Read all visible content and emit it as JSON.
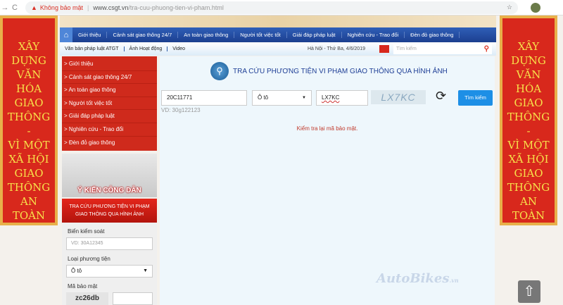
{
  "browser": {
    "security_label": "Không bảo mật",
    "domain": "www.csgt.vn",
    "path": "/tra-cuu-phuong-tien-vi-pham.html"
  },
  "banner": {
    "lines": [
      "XÂY",
      "DỰNG",
      "VĂN HÓA",
      "GIAO",
      "THÔNG",
      "-",
      "VÌ MỘT",
      "XÃ HỘI",
      "GIAO",
      "THÔNG",
      "AN TOÀN"
    ]
  },
  "main_nav": [
    "Giới thiệu",
    "Cảnh sát giao thông 24/7",
    "An toàn giao thông",
    "Người tốt việc tốt",
    "Giải đáp pháp luật",
    "Nghiên cứu - Trao đổi",
    "Đèn đỏ giao thông"
  ],
  "sub_nav": [
    "Văn bản pháp luật ATGT",
    "Ảnh Hoạt động",
    "Video"
  ],
  "date": "Hà Nội - Thứ Ba, 4/6/2019",
  "search_placeholder": "Tìm kiếm",
  "side_menu": [
    "Giới thiệu",
    "Cảnh sát giao thông 24/7",
    "An toàn giao thông",
    "Người tốt việc tốt",
    "Giải đáp pháp luật",
    "Nghiên cứu - Trao đổi",
    "Đèn đỏ giao thông"
  ],
  "ykien": "Ý KIẾN CÔNG DÂN",
  "side_box": {
    "title": "TRA CỨU PHƯƠNG TIỆN VI PHẠM GIAO THÔNG QUA HÌNH ẢNH",
    "plate_label": "Biển kiểm soát",
    "plate_placeholder": "VD: 30A12345",
    "type_label": "Loại phương tiện",
    "type_value": "Ô tô",
    "captcha_label": "Mã bảo mật",
    "captcha": "zc26db"
  },
  "content": {
    "title": "TRA CỨU PHƯƠNG TIỆN VI PHẠM GIAO THÔNG QUA HÌNH ẢNH",
    "plate": "20C11771",
    "type": "Ô tô",
    "captcha_input": "LX7KC",
    "captcha": "LX7KC",
    "hint": "VD: 30g122123",
    "button": "Tìm kiếm",
    "error": "Kiểm tra lại mã bảo mật.",
    "logo": "AutoBikes",
    "logo_tld": ".vn"
  }
}
